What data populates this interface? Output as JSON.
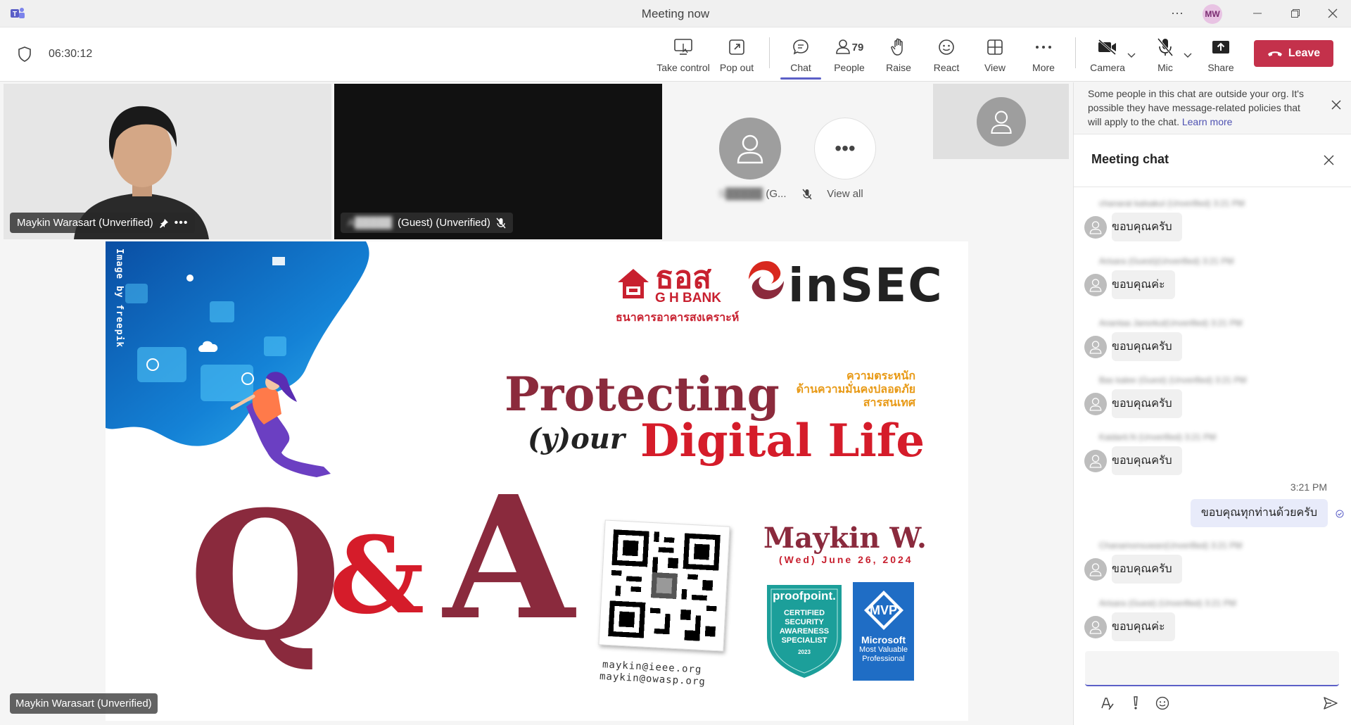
{
  "window": {
    "title": "Meeting now",
    "more_label": "⋯",
    "user_initials": "MW"
  },
  "meeting": {
    "timer": "06:30:12",
    "participant_count": "79",
    "buttons": {
      "take_control": "Take control",
      "pop_out": "Pop out",
      "chat": "Chat",
      "people": "People",
      "raise": "Raise",
      "react": "React",
      "view": "View",
      "more": "More",
      "camera": "Camera",
      "mic": "Mic",
      "share": "Share",
      "leave": "Leave"
    }
  },
  "stage": {
    "presenter_name": "Maykin Warasart (Unverified)",
    "guest_name_blurred": "A█████",
    "guest_suffix": "(Guest) (Unverified)",
    "participant_g_blurred": "S█████",
    "participant_g_suffix": "(G...",
    "view_all": "View all",
    "bottom_name": "Maykin Warasart (Unverified)"
  },
  "slide": {
    "credit": "Image by freepik",
    "bank_name": "ธอส",
    "bank_sub": "G H BANK",
    "bank_thai": "ธนาคารอาคารสงเคราะห์",
    "insec": "inSEC",
    "title_1": "Protecting",
    "title_2": "(y)our",
    "title_3": "Digital Life",
    "thai_tag_1": "ความตระหนัก",
    "thai_tag_2": "ด้านความมั่นคงปลอดภัย",
    "thai_tag_3": "สารสนเทศ",
    "qa_q": "Q",
    "qa_amp": "&",
    "qa_a": "A",
    "speaker": "Maykin W.",
    "date": "(Wed) June 26, 2024",
    "email_1": "maykin@ieee.org",
    "email_2": "maykin@owasp.org",
    "proofpoint": "proofpoint.",
    "proofpoint_cert": [
      "CERTIFIED",
      "SECURITY",
      "AWARENESS",
      "SPECIALIST"
    ],
    "proofpoint_year": "2023",
    "mvp": "MVP",
    "mvp_ms": "Microsoft",
    "mvp_sub_1": "Most Valuable",
    "mvp_sub_2": "Professional"
  },
  "chat": {
    "notice": "Some people in this chat are outside your org. It's possible they have message-related policies that will apply to the chat.",
    "notice_link": "Learn more",
    "title": "Meeting chat",
    "messages": [
      {
        "meta": "chanarat kalsakul (Unverified)  3:21 PM",
        "text": "ขอบคุณครับ"
      },
      {
        "meta": "Arisara (Guest)(Unverified)  3:21 PM",
        "text": "ขอบคุณค่ะ"
      },
      {
        "meta": "Anantaa Janorkul(Unverified)  3:21 PM",
        "text": "ขอบคุณครับ"
      },
      {
        "meta": "Bas kalee (Guest) (Unverified)  3:21 PM",
        "text": "ขอบคุณครับ"
      },
      {
        "meta": "Kaidarit.N (Unverified)  3:21 PM",
        "text": "ขอบคุณครับ"
      },
      {
        "meta": "Chanamonsuwan(Unverified)  3:21 PM",
        "text": "ขอบคุณครับ"
      },
      {
        "meta": "Arisara (Guest) (Unverified)  3:21 PM",
        "text": "ขอบคุณค่ะ"
      }
    ],
    "my_time": "3:21 PM",
    "my_message": "ขอบคุณทุกท่านด้วยครับ",
    "compose_value": ""
  }
}
